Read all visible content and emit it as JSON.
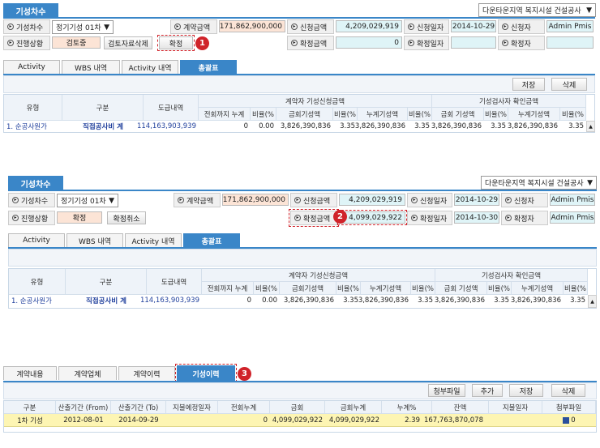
{
  "section1": {
    "tab_title": "기성차수",
    "company": "다운타운지역 복지시설 건설공사",
    "labels": {
      "round": "기성차수",
      "contract_amount": "계약금액",
      "request_amount": "신청금액",
      "request_date": "신청일자",
      "requester": "신청자",
      "progress": "진행상황",
      "confirm_amount": "확정금액",
      "confirm_date": "확정일자",
      "confirmer": "확정자"
    },
    "round_value": "정기기성 01차",
    "contract_amount": "171,862,900,000",
    "request_amount": "4,209,029,919",
    "request_date": "2014-10-29",
    "requester": "Admin Pmis",
    "status": "검토중",
    "btn_delete": "검토자료삭제",
    "btn_confirm": "확정",
    "confirm_amount": "0",
    "confirm_date": "",
    "confirmer": "",
    "badge": "1"
  },
  "tabs": [
    "Activity",
    "WBS 내역",
    "Activity 내역",
    "총괄표"
  ],
  "toolbar": {
    "save": "저장",
    "delete": "삭제"
  },
  "table": {
    "h_type": "유형",
    "h_div": "구분",
    "h_sub": "도급내역",
    "h_group1": "계약자 기성신청금액",
    "h_group2": "기성검사자 확인금액",
    "cols1": [
      "전회까지 누계",
      "비율(%",
      "금회기성액",
      "비율(%",
      "누계기성액",
      "비율(%"
    ],
    "cols2": [
      "금회 기성액",
      "비율(%",
      "누계기성액",
      "비율(%"
    ],
    "row": {
      "type": "1. 순공사원가",
      "div": "직접공사비 계",
      "sub": "114,163,903,939",
      "c1": "0",
      "c2": "0.00",
      "c3": "3,826,390,836",
      "c4": "3.35",
      "c5": "3,826,390,836",
      "c6": "3.35",
      "d1": "3,826,390,836",
      "d2": "3.35",
      "d3": "3,826,390,836",
      "d4": "3.35"
    }
  },
  "section2": {
    "tab_title": "기성차수",
    "company": "다운타운지역 복지시설 건설공사",
    "round_value": "정기기성 01차",
    "contract_amount": "171,862,900,000",
    "request_amount": "4,209,029,919",
    "request_date": "2014-10-29",
    "requester": "Admin Pmis",
    "status": "확정",
    "btn_cancel": "확정취소",
    "confirm_amount": "4,099,029,922",
    "confirm_date": "2014-10-30",
    "confirmer": "Admin Pmis",
    "badge": "2"
  },
  "section3": {
    "tabs": [
      "계약내용",
      "계약업체",
      "계약이력",
      "기성이력"
    ],
    "badge": "3",
    "buttons": [
      "청부파일",
      "추가",
      "저장",
      "삭제"
    ],
    "headers": [
      "구분",
      "산출기간 (From)",
      "산출기간 (To)",
      "지불예정일자",
      "전회누계",
      "금회",
      "금회누계",
      "누계%",
      "잔액",
      "지불일자",
      "첨부파일"
    ],
    "row": [
      "1차 기성",
      "2012-08-01",
      "2014-09-29",
      "",
      "0",
      "4,099,029,922",
      "4,099,029,922",
      "2.39",
      "167,763,870,078",
      "",
      "0"
    ]
  }
}
